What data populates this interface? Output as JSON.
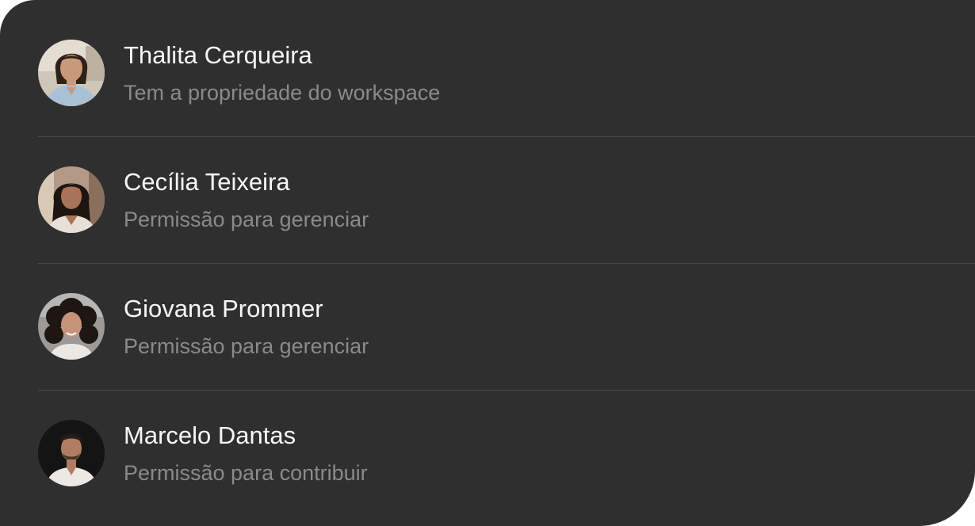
{
  "members": [
    {
      "name": "Thalita Cerqueira",
      "role": "Tem a propriedade do workspace",
      "avatar_icon": "woman-portrait-avatar"
    },
    {
      "name": "Cecília Teixeira",
      "role": "Permissão para gerenciar",
      "avatar_icon": "woman-portrait-avatar"
    },
    {
      "name": "Giovana Prommer",
      "role": "Permissão para gerenciar",
      "avatar_icon": "woman-portrait-avatar"
    },
    {
      "name": "Marcelo Dantas",
      "role": "Permissão para contribuir",
      "avatar_icon": "man-portrait-avatar"
    }
  ],
  "colors": {
    "panel_background": "#2f2f2f",
    "name_text": "#f7f7f7",
    "role_text": "#8a8a8a",
    "divider": "#4a4a4a"
  }
}
